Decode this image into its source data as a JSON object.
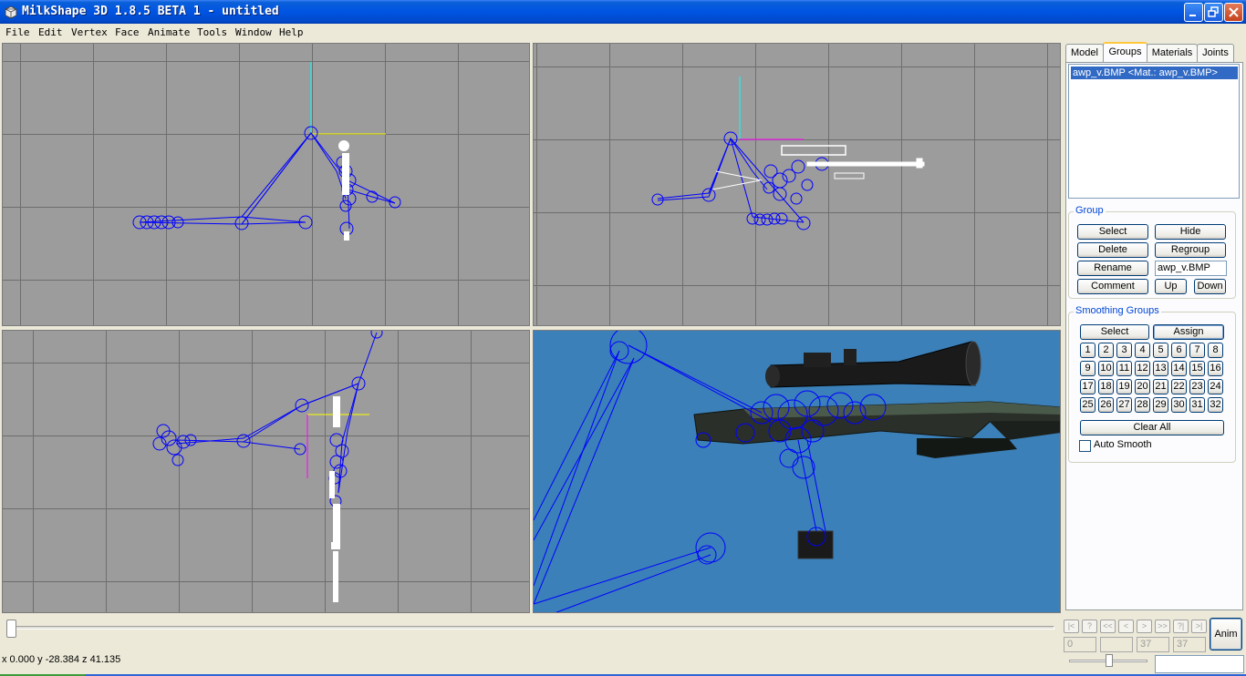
{
  "window": {
    "title": "MilkShape 3D 1.8.5 BETA 1 - untitled"
  },
  "menu": [
    "File",
    "Edit",
    "Vertex",
    "Face",
    "Animate",
    "Tools",
    "Window",
    "Help"
  ],
  "tabs": [
    "Model",
    "Groups",
    "Materials",
    "Joints"
  ],
  "active_tab": "Groups",
  "groups_list": [
    "awp_v.BMP <Mat.: awp_v.BMP>"
  ],
  "group": {
    "label": "Group",
    "select": "Select",
    "hide": "Hide",
    "delete": "Delete",
    "regroup": "Regroup",
    "rename": "Rename",
    "name_value": "awp_v.BMP",
    "comment": "Comment",
    "up": "Up",
    "down": "Down"
  },
  "smoothing": {
    "label": "Smoothing Groups",
    "select": "Select",
    "assign": "Assign",
    "numbers": [
      "1",
      "2",
      "3",
      "4",
      "5",
      "6",
      "7",
      "8",
      "9",
      "10",
      "11",
      "12",
      "13",
      "14",
      "15",
      "16",
      "17",
      "18",
      "19",
      "20",
      "21",
      "22",
      "23",
      "24",
      "25",
      "26",
      "27",
      "28",
      "29",
      "30",
      "31",
      "32"
    ],
    "clear_all": "Clear All",
    "auto_smooth": "Auto Smooth",
    "auto_smooth_checked": false
  },
  "status": {
    "coords": "x 0.000 y -28.384 z 41.135"
  },
  "timeline": {
    "buttons": [
      "|<",
      "?",
      "<<",
      "<",
      ">",
      ">>",
      "?|",
      ">|"
    ],
    "frame": "0",
    "frame_b": "",
    "frame_c": "37",
    "frame_d": "37",
    "anim": "Anim"
  },
  "colors": {
    "title_bar": "#0054e3",
    "viewport_bg": "#9c9c9c",
    "perspective_bg": "#3b80b8",
    "skeleton": "#0000ff",
    "selection": "#316ac5"
  }
}
